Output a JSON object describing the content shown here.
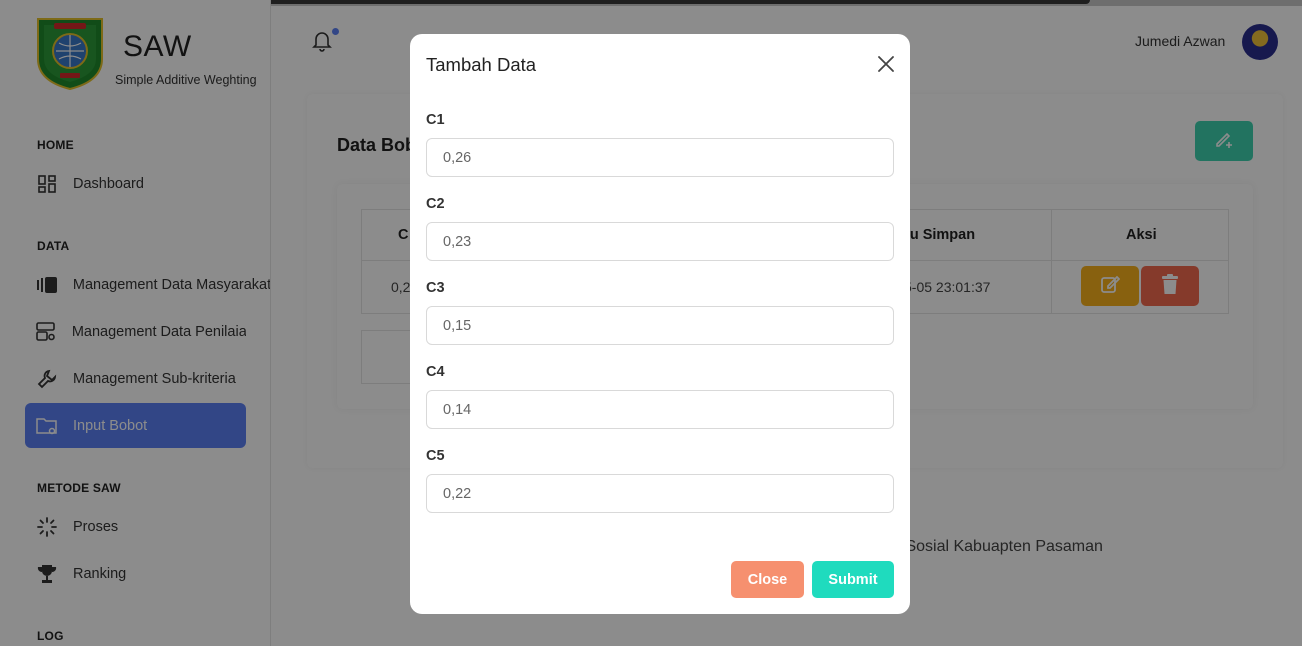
{
  "app": {
    "brand": "SAW",
    "brand_sub": "Simple Additive Weghting",
    "user_name": "Jumedi Azwan"
  },
  "sidebar": {
    "sections": [
      {
        "title": "HOME",
        "items": [
          {
            "label": "Dashboard",
            "icon": "dashboard-icon"
          }
        ]
      },
      {
        "title": "DATA",
        "items": [
          {
            "label": "Management Data Masyarakat",
            "icon": "data-masyarakat-icon"
          },
          {
            "label": "Management Data Penilaian",
            "icon": "data-penilaian-icon"
          },
          {
            "label": "Management Sub-kriteria",
            "icon": "wrench-icon"
          },
          {
            "label": "Input Bobot",
            "icon": "folder-gear-icon",
            "active": true
          }
        ]
      },
      {
        "title": "METODE SAW",
        "items": [
          {
            "label": "Proses",
            "icon": "loading-icon"
          },
          {
            "label": "Ranking",
            "icon": "trophy-icon"
          }
        ]
      },
      {
        "title": "LOG",
        "items": []
      }
    ]
  },
  "main": {
    "title": "Data Bob",
    "table": {
      "headers": [
        "C",
        "tu Simpan",
        "Aksi"
      ],
      "row": [
        "0,2",
        "5-05 23:01:37"
      ]
    },
    "footer": "s Sosial Kabuapten Pasaman"
  },
  "modal": {
    "title": "Tambah Data",
    "fields": [
      {
        "label": "C1",
        "value": "0,26"
      },
      {
        "label": "C2",
        "value": "0,23"
      },
      {
        "label": "C3",
        "value": "0,15"
      },
      {
        "label": "C4",
        "value": "0,14"
      },
      {
        "label": "C5",
        "value": "0,22"
      }
    ],
    "close_label": "Close",
    "submit_label": "Submit"
  },
  "colors": {
    "primary": "#5b80f5",
    "success": "#1fdbbe",
    "warning": "#f7b11d",
    "danger": "#f36b4f",
    "close_btn": "#f6906f"
  }
}
